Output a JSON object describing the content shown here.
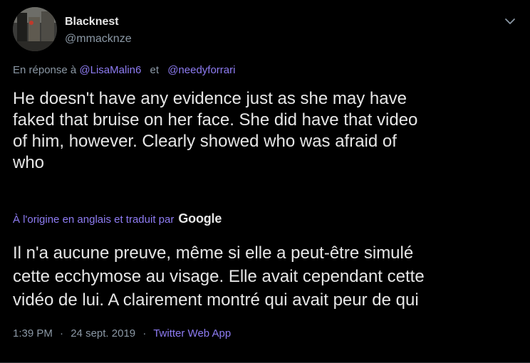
{
  "author": {
    "display_name": "Blacknest",
    "handle": "@mmacknze"
  },
  "reply": {
    "prefix": "En réponse à",
    "to_1": "@LisaMalin6",
    "separator": "et",
    "to_2": "@needyforrari"
  },
  "tweet": {
    "text": "He doesn't have any evidence just as she may have\nfaked that bruise on her face.  She did have that video\nof him, however.   Clearly showed who was afraid of\nwho"
  },
  "translation": {
    "label": "À l'origine en anglais et traduit par",
    "provider": "Google",
    "text": "Il n'a aucune preuve, même si elle a peut-être simulé\ncette ecchymose au visage. Elle avait cependant cette\nvidéo de lui. A clairement montré qui avait peur de qui"
  },
  "meta": {
    "time": "1:39 PM",
    "date": "24 sept. 2019",
    "separator": "·",
    "source_app": "Twitter Web App"
  },
  "icons": {
    "menu": "chevron-down-icon",
    "avatar": "profile-photo"
  },
  "colors": {
    "background": "#000000",
    "text": "#e6e6e6",
    "secondary": "#8b98a5",
    "link": "#8e7cf3"
  }
}
